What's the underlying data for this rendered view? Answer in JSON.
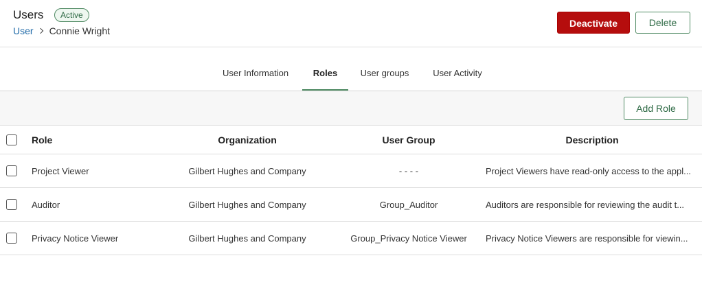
{
  "header": {
    "title": "Users",
    "status_badge": "Active",
    "breadcrumb": {
      "parent": "User",
      "current": "Connie Wright"
    },
    "deactivate_label": "Deactivate",
    "delete_label": "Delete"
  },
  "tabs": [
    {
      "label": "User Information",
      "active": false
    },
    {
      "label": "Roles",
      "active": true
    },
    {
      "label": "User groups",
      "active": false
    },
    {
      "label": "User Activity",
      "active": false
    }
  ],
  "toolbar": {
    "add_role_label": "Add Role"
  },
  "table": {
    "columns": [
      "Role",
      "Organization",
      "User Group",
      "Description"
    ],
    "rows": [
      {
        "role": "Project Viewer",
        "organization": "Gilbert Hughes and Company",
        "user_group": "- - - -",
        "description": "Project Viewers have read-only access to the appl..."
      },
      {
        "role": "Auditor",
        "organization": "Gilbert Hughes and Company",
        "user_group": "Group_Auditor",
        "description": "Auditors are responsible for reviewing the audit t..."
      },
      {
        "role": "Privacy Notice Viewer",
        "organization": "Gilbert Hughes and Company",
        "user_group": "Group_Privacy Notice Viewer",
        "description": "Privacy Notice Viewers are responsible for viewin..."
      }
    ]
  },
  "colors": {
    "accent_green": "#4f8a63",
    "danger_red": "#b50d0d",
    "link_blue": "#1f6aa8"
  }
}
